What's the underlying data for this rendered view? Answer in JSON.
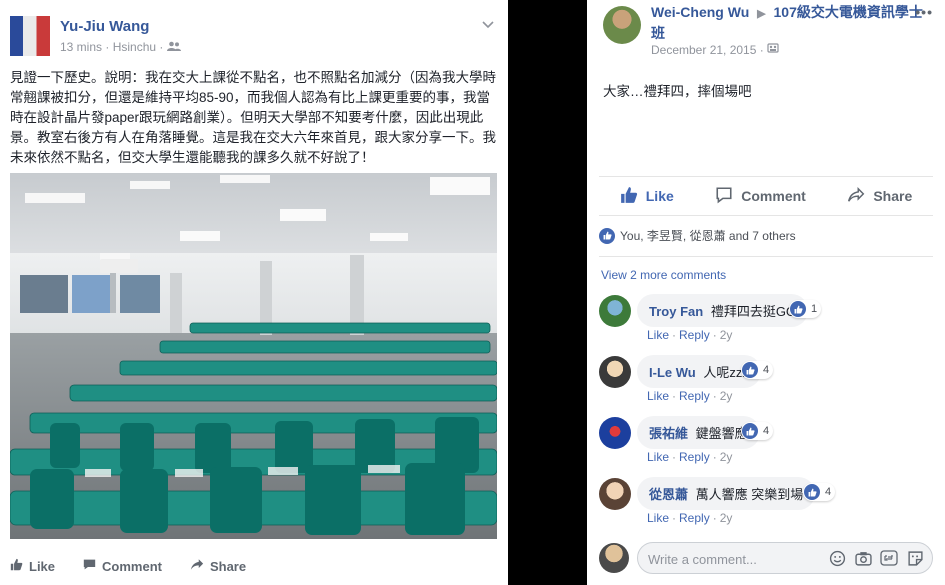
{
  "colors": {
    "link": "#365899",
    "accent": "#4267b2",
    "muted": "#90949c",
    "seat": "#1f8f83"
  },
  "left_post": {
    "author": "Yu-Jiu Wang",
    "time": "13 mins",
    "location": "Hsinchu",
    "privacy_icon": "friends-icon",
    "text": "見證一下歷史。說明：我在交大上課從不點名，也不照點名加減分（因為我大學時常翹課被扣分，但還是維持平均85-90，而我個人認為有比上課更重要的事，我當時在設計晶片發paper跟玩網路創業）。但明天大學部不知要考什麼，因此出現此景。教室右後方有人在角落睡覺。這是我在交大六年來首見，跟大家分享一下。我未來依然不點名，但交大學生還能聽我的課多久就不好說了！",
    "photo_alt_icon": "classroom-photo",
    "actions": {
      "like": "Like",
      "comment": "Comment",
      "share": "Share"
    }
  },
  "right_post": {
    "author": "Wei-Cheng Wu",
    "group": "107級交大電機資訊學士班",
    "date": "December 21, 2015",
    "body": "大家…禮拜四，摔個場吧",
    "actions": {
      "like": "Like",
      "comment": "Comment",
      "share": "Share"
    },
    "reactions_text": "You, 李昱賢, 從恩蕭 and 7 others",
    "view_more": "View 2 more comments",
    "comments": [
      {
        "name": "Troy Fan",
        "text": "禮拜四去挺GG",
        "likes": "1",
        "like": "Like",
        "reply": "Reply",
        "age": "2y"
      },
      {
        "name": "I-Le Wu",
        "text": "人呢zzz",
        "likes": "4",
        "like": "Like",
        "reply": "Reply",
        "age": "2y"
      },
      {
        "name": "張祐維",
        "text": "鍵盤響應",
        "likes": "4",
        "like": "Like",
        "reply": "Reply",
        "age": "2y"
      },
      {
        "name": "從恩蕭",
        "text": "萬人響應 突樂到場",
        "likes": "4",
        "like": "Like",
        "reply": "Reply",
        "age": "2y"
      }
    ],
    "comment_placeholder": "Write a comment...",
    "input_icons": [
      "emoji-icon",
      "camera-icon",
      "gif-icon",
      "sticker-icon"
    ]
  }
}
